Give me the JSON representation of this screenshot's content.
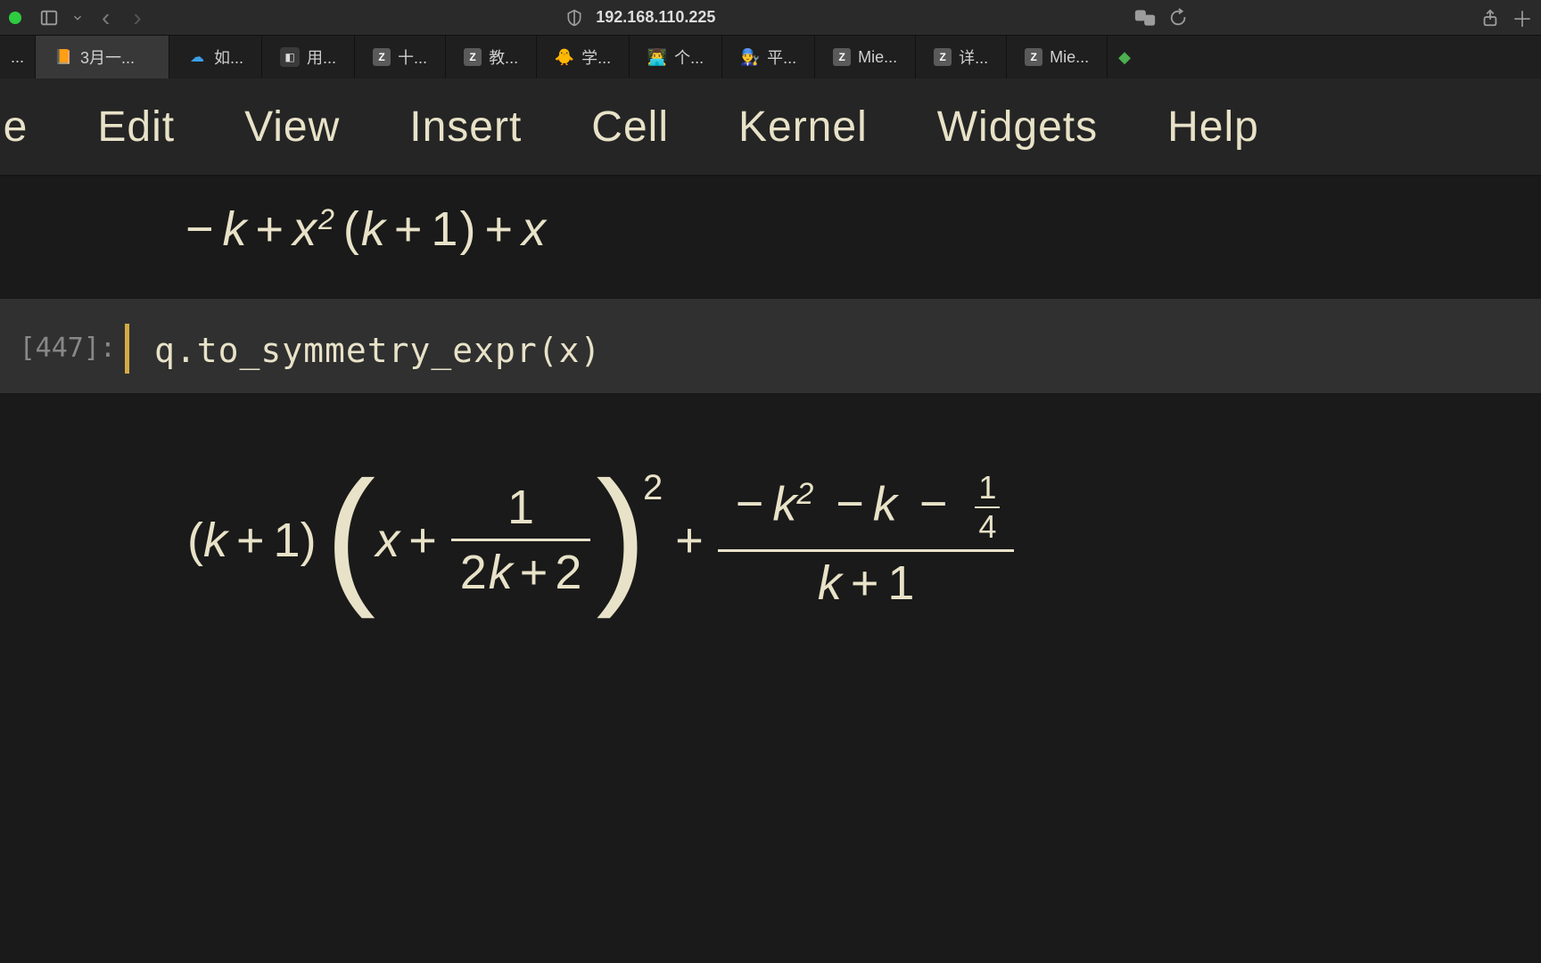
{
  "browser": {
    "address": "192.168.110.225"
  },
  "tabs": [
    {
      "label": "...",
      "icon": "none"
    },
    {
      "label": "3月一...",
      "icon": "book",
      "active": true
    },
    {
      "label": "如...",
      "icon": "cloud"
    },
    {
      "label": "用...",
      "icon": "darksq"
    },
    {
      "label": "十...",
      "icon": "z"
    },
    {
      "label": "教...",
      "icon": "z"
    },
    {
      "label": "学...",
      "icon": "chick"
    },
    {
      "label": "个...",
      "icon": "person"
    },
    {
      "label": "平...",
      "icon": "dev"
    },
    {
      "label": "Mie...",
      "icon": "z"
    },
    {
      "label": "详...",
      "icon": "z"
    },
    {
      "label": "Mie...",
      "icon": "z"
    }
  ],
  "menu": [
    "le",
    "Edit",
    "View",
    "Insert",
    "Cell",
    "Kernel",
    "Widgets",
    "Help"
  ],
  "cells": {
    "output1": {
      "minus": "−",
      "k": "k",
      "plus": "+",
      "x": "x",
      "sq": "2",
      "lp": "(",
      "rp": ")",
      "one": "1"
    },
    "input": {
      "prompt": "[447]:",
      "code": "q.to_symmetry_expr(x)"
    },
    "output2": {
      "k": "k",
      "plus": "+",
      "one": "1",
      "x": "x",
      "two": "2",
      "minus": "−",
      "quarter_num": "1",
      "quarter_den": "4"
    }
  }
}
